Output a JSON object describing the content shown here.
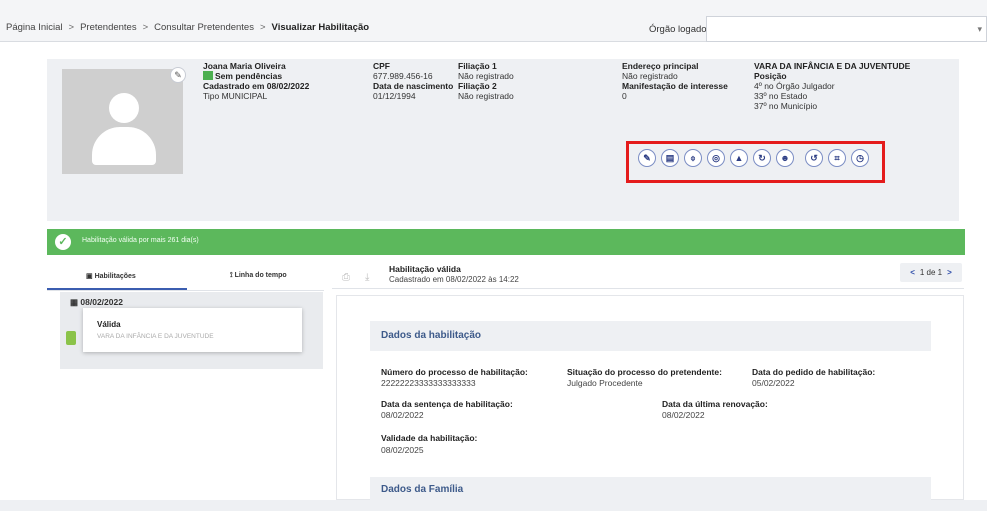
{
  "breadcrumb": {
    "items": [
      "Página Inicial",
      "Pretendentes",
      "Consultar Pretendentes"
    ],
    "current": "Visualizar Habilitação",
    "separator": ">"
  },
  "header": {
    "orgao_label": "Órgão logado",
    "orgao_value": ""
  },
  "profile": {
    "name": "Joana Maria Oliveira",
    "status": "Sem pendências",
    "status_color": "#4caf50",
    "cadastrado": "Cadastrado em 08/02/2022",
    "tipo": "Tipo MUNICIPAL",
    "cpf_label": "CPF",
    "cpf_value": "677.989.456-16",
    "nascimento_label": "Data de nascimento",
    "nascimento_value": "01/12/1994",
    "filiacao1_label": "Filiação 1",
    "filiacao1_value": "Não registrado",
    "filiacao2_label": "Filiação 2",
    "filiacao2_value": "Não registrado",
    "endereco_label": "Endereço principal",
    "endereco_value": "Não registrado",
    "manifestacao_label": "Manifestação de interesse",
    "manifestacao_value": "0",
    "vara": "VARA DA INFÂNCIA E DA JUVENTUDE",
    "posicao_label": "Posição",
    "posicao_orgao": "4º no Órgão Julgador",
    "posicao_estado": "33º no Estado",
    "posicao_municipio": "37º no Município"
  },
  "actions": [
    {
      "icon": "pencil-icon",
      "glyph": "✎"
    },
    {
      "icon": "document-icon",
      "glyph": "▤"
    },
    {
      "icon": "attachment-icon",
      "glyph": "⌽"
    },
    {
      "icon": "chat-icon",
      "glyph": "◎"
    },
    {
      "icon": "warning-icon",
      "glyph": "▲"
    },
    {
      "icon": "refresh-icon",
      "glyph": "↻"
    },
    {
      "icon": "user-icon",
      "glyph": "☻"
    },
    {
      "icon": "undo-icon",
      "glyph": "↺"
    },
    {
      "icon": "crop-icon",
      "glyph": "⌗"
    },
    {
      "icon": "history-icon",
      "glyph": "◷"
    }
  ],
  "validity": {
    "text": "Habilitação válida por mais 261 dia(s)",
    "color": "#5cb85c"
  },
  "tabs": {
    "habilitacoes": "Habilitações",
    "linha_tempo": "Linha do tempo"
  },
  "timeline": {
    "date": "08/02/2022",
    "card_title": "Válida",
    "card_subtitle": "VARA DA INFÂNCIA E DA JUVENTUDE"
  },
  "habilitacao": {
    "title": "Habilitação válida",
    "subtitle": "Cadastrado em 08/02/2022 às 14:22",
    "pager": "1 de 1"
  },
  "dados": {
    "section_title": "Dados da habilitação",
    "processo_label": "Número do processo de habilitação:",
    "processo_value": "22222223333333333333",
    "situacao_label": "Situação do processo do pretendente:",
    "situacao_value": "Julgado Procedente",
    "pedido_label": "Data do pedido de habilitação:",
    "pedido_value": "05/02/2022",
    "sentenca_label": "Data da sentença de habilitação:",
    "sentenca_value": "08/02/2022",
    "renovacao_label": "Data da última renovação:",
    "renovacao_value": "08/02/2022",
    "validade_label": "Validade da habilitação:",
    "validade_value": "08/02/2025"
  },
  "familia": {
    "section_title": "Dados da Família"
  }
}
